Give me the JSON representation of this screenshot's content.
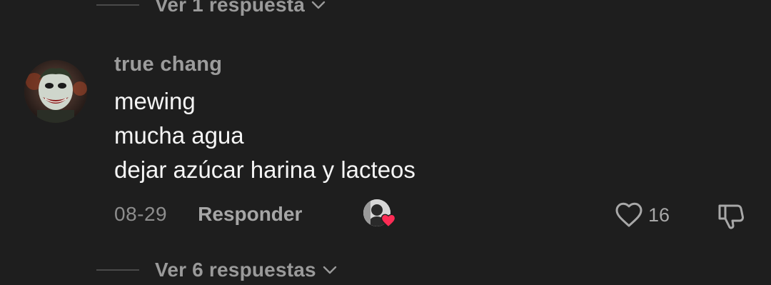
{
  "replies_top": {
    "label": "Ver 1 respuesta"
  },
  "comment": {
    "username": "true chang",
    "lines": [
      "mewing",
      "mucha agua",
      "dejar azúcar harina y lacteos"
    ],
    "date": "08-29",
    "reply_label": "Responder",
    "like_count": "16"
  },
  "replies_bottom": {
    "label": "Ver 6 respuestas"
  },
  "icons": {
    "chevron": "chevron-down-icon",
    "like": "heart-outline-icon",
    "dislike": "thumbs-down-icon",
    "creator_like": "heart-filled-icon"
  },
  "colors": {
    "background": "#1e1e1e",
    "text_primary": "#f5f5f5",
    "text_secondary": "#9c9c9c",
    "heart_accent": "#fe2c55"
  }
}
